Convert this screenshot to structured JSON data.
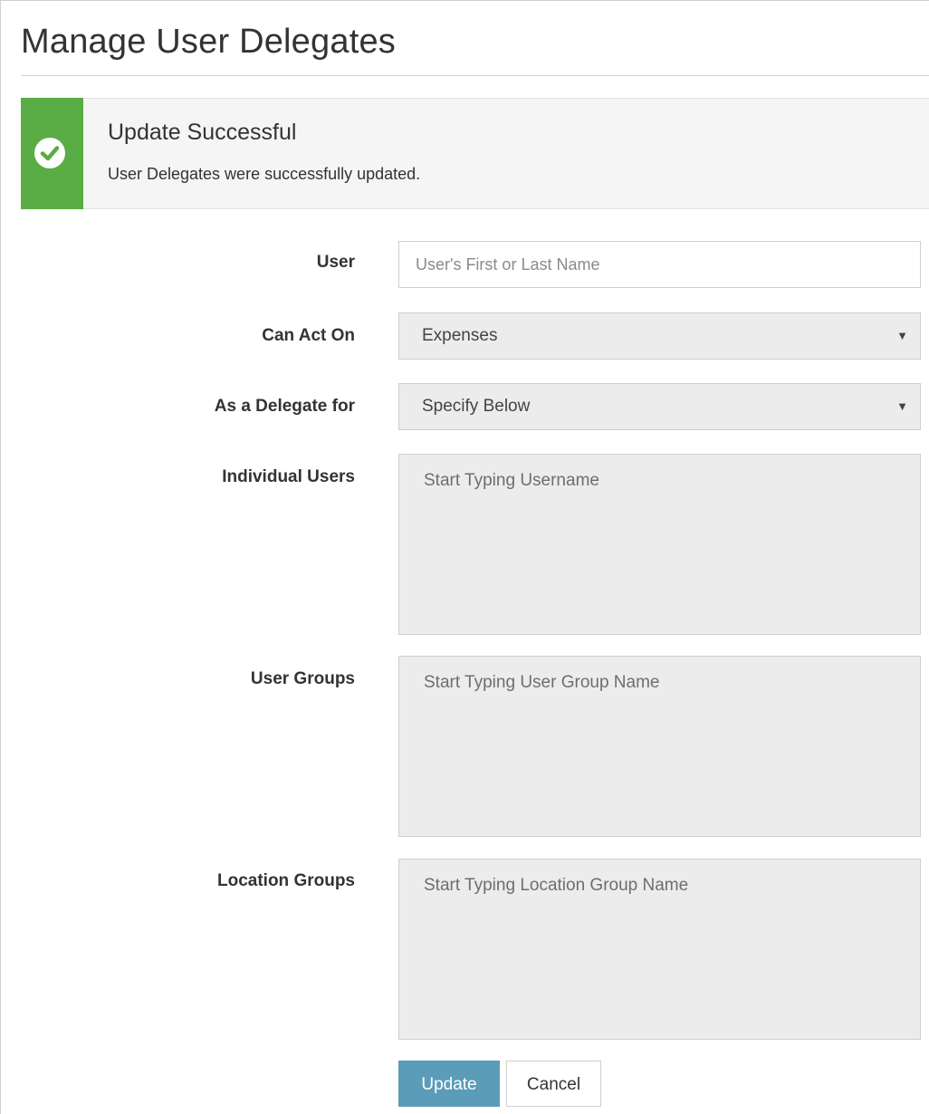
{
  "page": {
    "title": "Manage User Delegates"
  },
  "alert": {
    "icon": "check-circle-icon",
    "title": "Update Successful",
    "message": "User Delegates were successfully updated.",
    "color": "#5aac44"
  },
  "form": {
    "user": {
      "label": "User",
      "value": "",
      "placeholder": "User's First or Last Name"
    },
    "can_act_on": {
      "label": "Can Act On",
      "selected": "Expenses"
    },
    "delegate_for": {
      "label": "As a Delegate for",
      "selected": "Specify Below"
    },
    "individual_users": {
      "label": "Individual Users",
      "placeholder": "Start Typing Username"
    },
    "user_groups": {
      "label": "User Groups",
      "placeholder": "Start Typing User Group Name"
    },
    "location_groups": {
      "label": "Location Groups",
      "placeholder": "Start Typing Location Group Name"
    }
  },
  "actions": {
    "update_label": "Update",
    "cancel_label": "Cancel",
    "primary_color": "#5b9cb8"
  }
}
